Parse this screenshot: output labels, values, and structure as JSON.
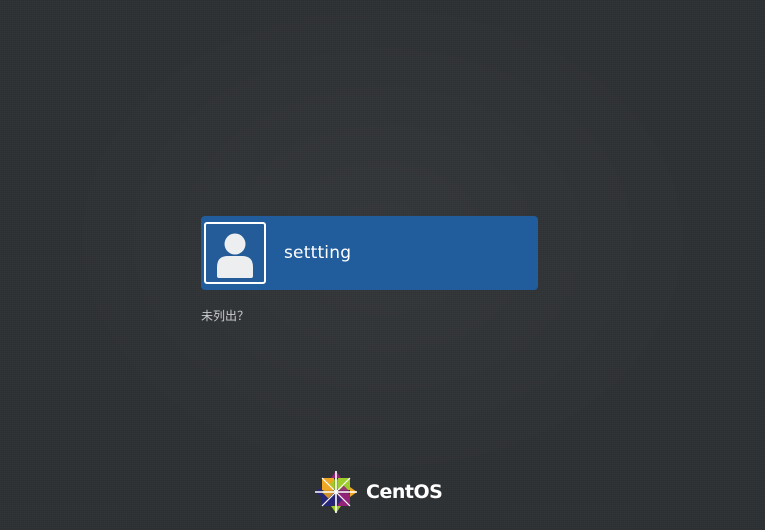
{
  "users": [
    {
      "name": "settting"
    }
  ],
  "not_listed_label": "未列出？",
  "brand": {
    "name": "CentOS",
    "logo_icon": "centos-logo-icon"
  },
  "colors": {
    "background": "#2e3134",
    "selected_user": "#215d9c",
    "avatar_border": "#ffffff",
    "link_text": "#c8cacb"
  }
}
